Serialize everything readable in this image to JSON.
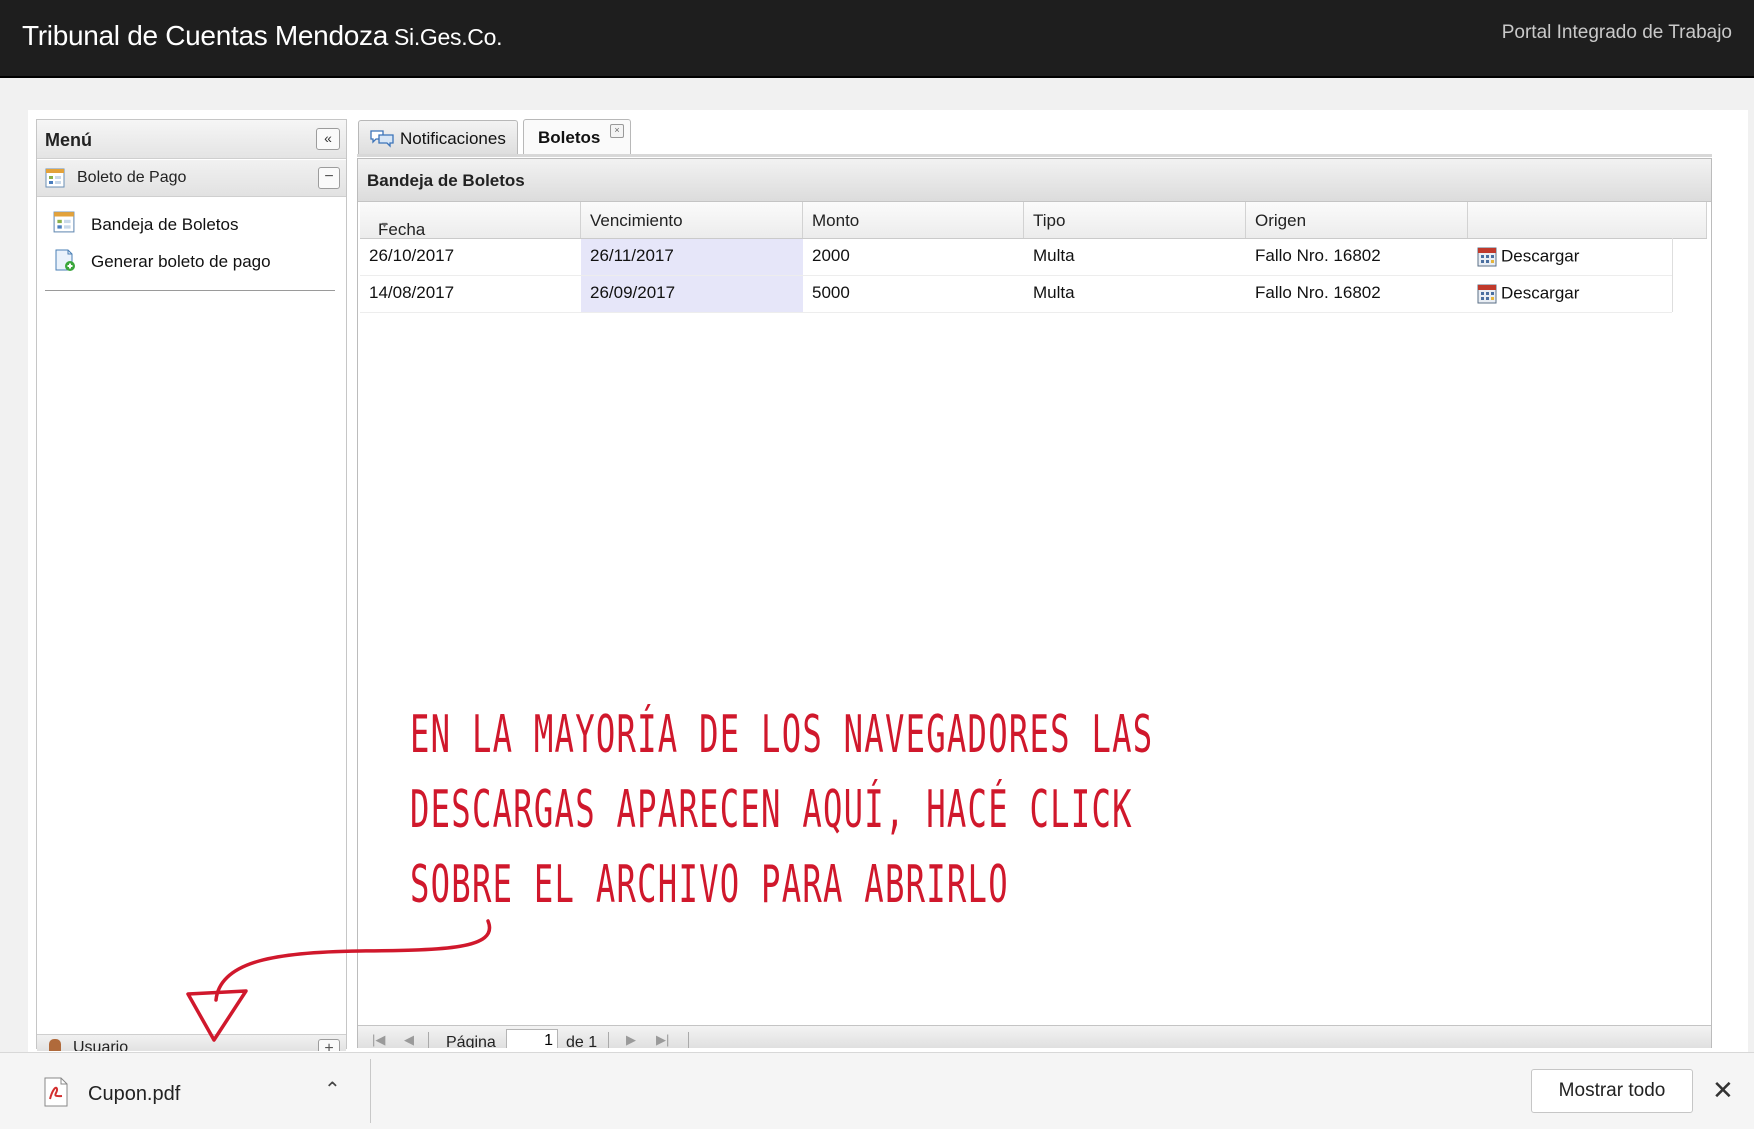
{
  "topbar": {
    "title": "Tribunal de Cuentas Mendoza",
    "subtitle": "Si.Ges.Co.",
    "portal_link": "Portal Integrado de Trabajo",
    "background": "#1e1e1e"
  },
  "menu": {
    "header": "Menú",
    "collapse_glyph": "«",
    "section": {
      "label": "Boleto de Pago",
      "toggle_glyph": "−",
      "items": [
        {
          "label": "Bandeja de Boletos",
          "icon": "grid-report-icon"
        },
        {
          "label": "Generar boleto de pago",
          "icon": "document-add-icon"
        }
      ]
    },
    "user_section": {
      "label": "Usuario",
      "toggle_glyph": "+"
    }
  },
  "tabs": [
    {
      "label": "Notificaciones",
      "icon": "speech-bubbles-icon",
      "active": false
    },
    {
      "label": "Boletos",
      "active": true,
      "closable": true,
      "close_glyph": "×"
    }
  ],
  "panel": {
    "title": "Bandeja de Boletos",
    "columns": [
      "Fecha",
      "Vencimiento",
      "Monto",
      "Tipo",
      "Origen",
      ""
    ],
    "sort_glyph": "▾",
    "rows": [
      {
        "fecha": "26/10/2017",
        "vencimiento": "26/11/2017",
        "monto": "2000",
        "tipo": "Multa",
        "origen": "Fallo Nro. 16802",
        "action": "Descargar"
      },
      {
        "fecha": "14/08/2017",
        "vencimiento": "26/09/2017",
        "monto": "5000",
        "tipo": "Multa",
        "origen": "Fallo Nro. 16802",
        "action": "Descargar"
      }
    ],
    "pager": {
      "page_label": "Página",
      "page_value": "1",
      "of_label": "de 1",
      "first_glyph": "|◀",
      "prev_glyph": "◀",
      "next_glyph": "▶",
      "last_glyph": "▶|"
    }
  },
  "annotation": {
    "lines": [
      "En la mayoría de los navegadores las",
      "descargas aparecen aquí, hacé click",
      "sobre el archivo para abrirlo"
    ],
    "color": "#d0182c"
  },
  "download_bar": {
    "file_name": "Cupon.pdf",
    "file_icon": "pdf-file-icon",
    "chevron_glyph": "⌃",
    "show_all_label": "Mostrar todo",
    "close_glyph": "✕"
  }
}
